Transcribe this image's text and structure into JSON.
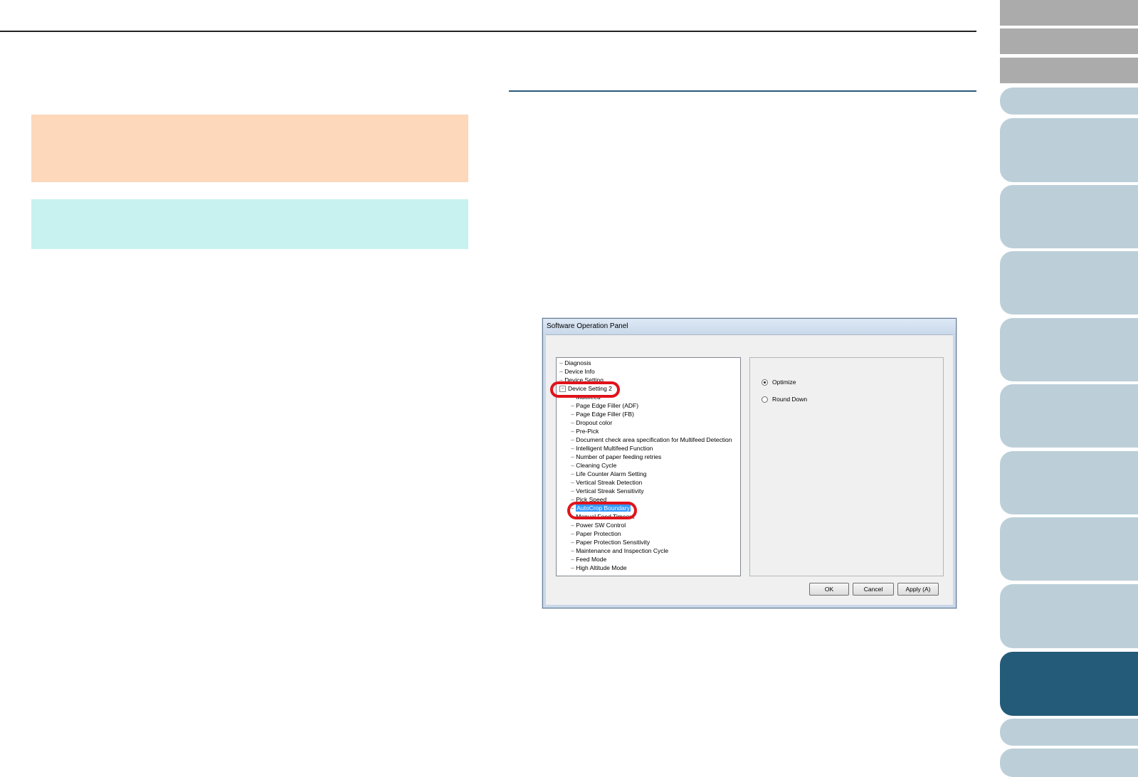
{
  "dialog": {
    "title": "Software Operation Panel",
    "tree": {
      "root_items": [
        "Diagnosis",
        "Device Info",
        "Device Setting",
        "Device Setting 2"
      ],
      "expanded_symbol": "−",
      "children": [
        "Multifeed",
        "Page Edge Filler (ADF)",
        "Page Edge Filler (FB)",
        "Dropout color",
        "Pre-Pick",
        "Document check area specification for Multifeed Detection",
        "Intelligent Multifeed Function",
        "Number of paper feeding retries",
        "Cleaning Cycle",
        "Life Counter Alarm Setting",
        "Vertical Streak Detection",
        "Vertical Streak Sensitivity",
        "Pick Speed",
        "AutoCrop Boundary",
        "Manual Feed Timeout",
        "Power SW Control",
        "Paper Protection",
        "Paper Protection Sensitivity",
        "Maintenance and Inspection Cycle",
        "Feed Mode",
        "High Altitude Mode"
      ],
      "selected": "AutoCrop Boundary"
    },
    "options": [
      {
        "label": "Optimize",
        "checked": true
      },
      {
        "label": "Round Down",
        "checked": false
      }
    ],
    "buttons": {
      "ok": "OK",
      "cancel": "Cancel",
      "apply": "Apply (A)"
    }
  },
  "colors": {
    "highlight": "#e0131b",
    "selection": "#3399ff",
    "tab_active": "#245b79",
    "tab_inactive": "#bccfd9",
    "tab_gray": "#ababab"
  }
}
